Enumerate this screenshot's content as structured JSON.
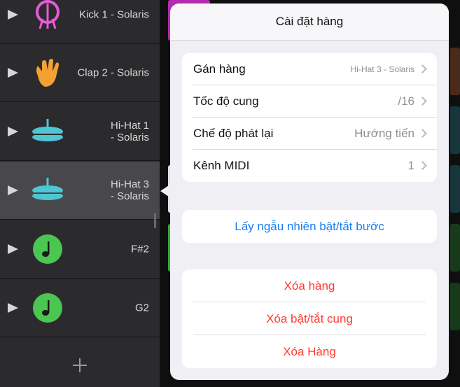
{
  "tracks": [
    {
      "name": "Kick 1 - Solaris",
      "icon": "drum-kit-icon",
      "color": "#e85ad8"
    },
    {
      "name": "Clap 2 - Solaris",
      "icon": "hand-clap-icon",
      "color": "#f5a033"
    },
    {
      "name_line1": "Hi-Hat 1",
      "name_line2": "- Solaris",
      "icon": "hi-hat-icon",
      "color": "#4ec6d4"
    },
    {
      "name_line1": "Hi-Hat 3",
      "name_line2": "- Solaris",
      "icon": "hi-hat-icon",
      "color": "#4ec6d4",
      "selected": true
    },
    {
      "name": "F#2",
      "icon": "music-note-icon",
      "color": "#4bc650"
    },
    {
      "name": "G2",
      "icon": "music-note-icon",
      "color": "#4bc650"
    }
  ],
  "popover": {
    "title": "Cài đặt hàng",
    "settings": [
      {
        "label": "Gán hàng",
        "value": "Hi-Hat 3 - Solaris"
      },
      {
        "label": "Tốc độ cung",
        "value": "/16"
      },
      {
        "label": "Chế độ phát lại",
        "value": "Hướng tiến"
      },
      {
        "label": "Kênh MIDI",
        "value": "1"
      }
    ],
    "randomize_label": "Lấy ngẫu nhiên bật/tắt bước",
    "clear_actions": [
      "Xóa hàng",
      "Xóa bật/tắt cung",
      "Xóa Hàng"
    ]
  },
  "colors": {
    "accent_blue": "#1a7ff0",
    "destructive_red": "#ff3b30"
  }
}
